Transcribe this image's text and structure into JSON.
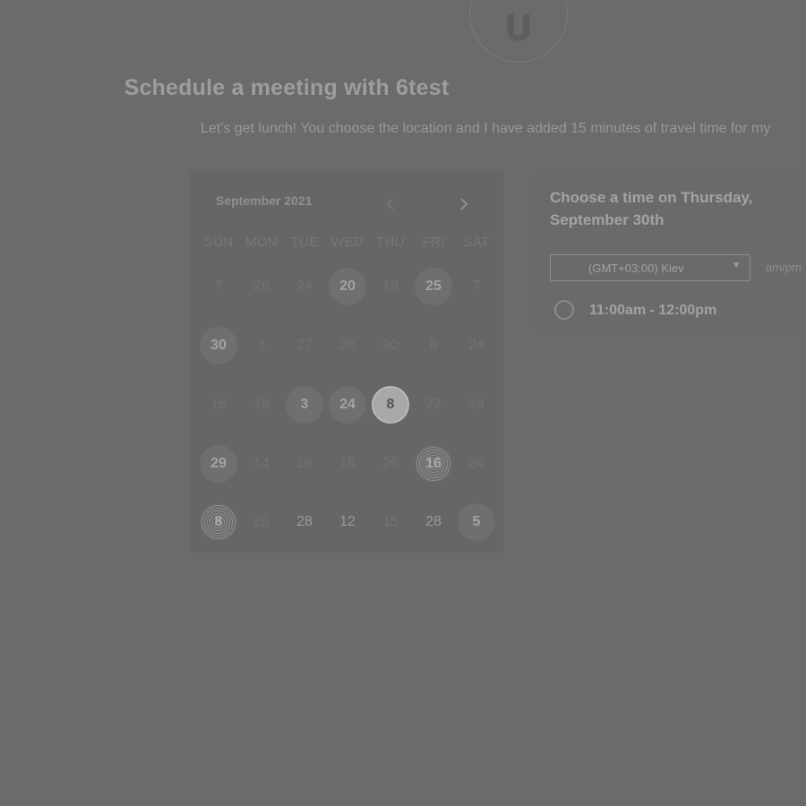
{
  "avatar": {
    "letter": "U"
  },
  "header": {
    "title": "Schedule a meeting with 6test",
    "subtitle": "Let's get lunch! You choose the location and I have added 15 minutes of travel time for my"
  },
  "calendar": {
    "month_label": "September 2021",
    "prev_icon": "chevron-left-icon",
    "next_icon": "chevron-right-icon",
    "weekdays": [
      "SUN",
      "MON",
      "TUE",
      "WED",
      "THU",
      "FRI",
      "SAT"
    ],
    "weeks": [
      [
        {
          "label": "7",
          "state": "disabled"
        },
        {
          "label": "26",
          "state": "disabled"
        },
        {
          "label": "24",
          "state": "disabled"
        },
        {
          "label": "20",
          "state": "available"
        },
        {
          "label": "19",
          "state": "disabled"
        },
        {
          "label": "25",
          "state": "available"
        },
        {
          "label": "7",
          "state": "disabled"
        }
      ],
      [
        {
          "label": "30",
          "state": "available"
        },
        {
          "label": "3",
          "state": "disabled"
        },
        {
          "label": "27",
          "state": "disabled"
        },
        {
          "label": "28",
          "state": "disabled"
        },
        {
          "label": "30",
          "state": "disabled"
        },
        {
          "label": "8",
          "state": "disabled"
        },
        {
          "label": "24",
          "state": "disabled"
        }
      ],
      [
        {
          "label": "16",
          "state": "disabled"
        },
        {
          "label": "19",
          "state": "disabled"
        },
        {
          "label": "3",
          "state": "available"
        },
        {
          "label": "24",
          "state": "available"
        },
        {
          "label": "8",
          "state": "selected"
        },
        {
          "label": "22",
          "state": "disabled"
        },
        {
          "label": "24",
          "state": "disabled"
        }
      ],
      [
        {
          "label": "29",
          "state": "available"
        },
        {
          "label": "14",
          "state": "disabled"
        },
        {
          "label": "16",
          "state": "disabled"
        },
        {
          "label": "18",
          "state": "disabled"
        },
        {
          "label": "26",
          "state": "disabled"
        },
        {
          "label": "16",
          "state": "dotted"
        },
        {
          "label": "24",
          "state": "disabled"
        }
      ],
      [
        {
          "label": "8",
          "state": "dotted"
        },
        {
          "label": "25",
          "state": "disabled"
        },
        {
          "label": "28",
          "state": "plain"
        },
        {
          "label": "12",
          "state": "plain"
        },
        {
          "label": "15",
          "state": "disabled"
        },
        {
          "label": "28",
          "state": "plain"
        },
        {
          "label": "5",
          "state": "available"
        }
      ]
    ]
  },
  "times": {
    "heading": "Choose a time on Thursday, September 30th",
    "timezone": "(GMT+03:00) Kiev",
    "format_label": "am/pm",
    "slots": [
      {
        "label": "11:00am - 12:00pm"
      }
    ]
  }
}
